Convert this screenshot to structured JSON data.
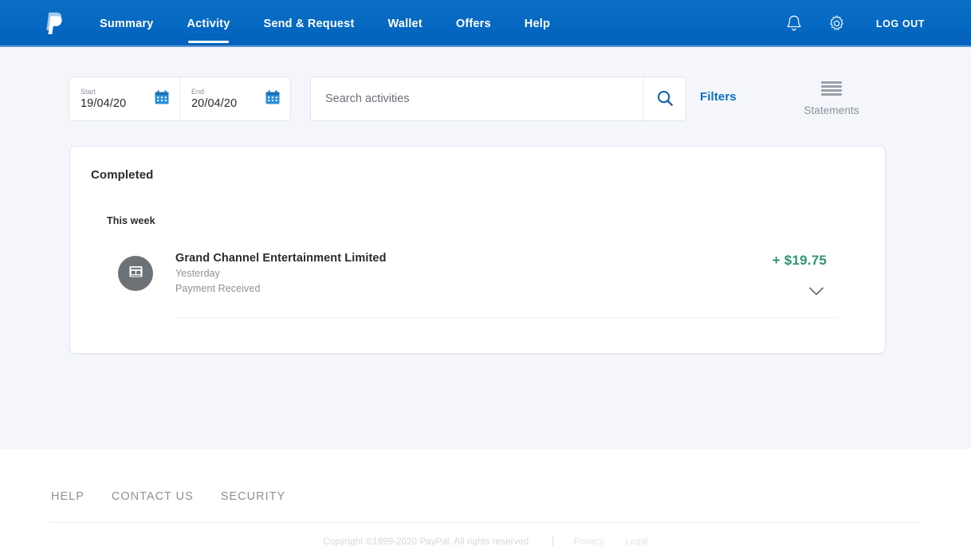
{
  "header": {
    "logo_alt": "paypal-logo",
    "nav": [
      {
        "label": "Summary",
        "active": false
      },
      {
        "label": "Activity",
        "active": true
      },
      {
        "label": "Send & Request",
        "active": false
      },
      {
        "label": "Wallet",
        "active": false
      },
      {
        "label": "Offers",
        "active": false
      },
      {
        "label": "Help",
        "active": false
      }
    ],
    "notifications_icon": "bell-icon",
    "settings_icon": "gear-icon",
    "logout_label": "LOG OUT",
    "background_color": "#0568c2"
  },
  "toolbar": {
    "start_date": {
      "label": "Start",
      "value": "19/04/20",
      "icon": "calendar-icon"
    },
    "end_date": {
      "label": "End",
      "value": "20/04/20",
      "icon": "calendar-icon"
    },
    "search": {
      "placeholder": "Search activities",
      "value": "",
      "button_icon": "search-icon"
    },
    "filters_label": "Filters",
    "filters_color": "#0f6fc5",
    "statements": {
      "label": "Statements",
      "icon": "statements-lines-icon"
    }
  },
  "activity": {
    "status_heading": "Completed",
    "group_heading": "This week",
    "transactions": [
      {
        "avatar_icon": "store-icon",
        "merchant": "Grand Channel Entertainment Limited",
        "date": "Yesterday",
        "type": "Payment Received",
        "amount": "+ $19.75",
        "amount_color": "#2f9470",
        "expand_icon": "chevron-down-icon"
      }
    ]
  },
  "footer": {
    "links": [
      "HELP",
      "CONTACT US",
      "SECURITY"
    ],
    "copyright": "Copyright ©1999-2020 PayPal. All rights reserved.",
    "mini_links": [
      "Privacy",
      "Legal"
    ]
  }
}
